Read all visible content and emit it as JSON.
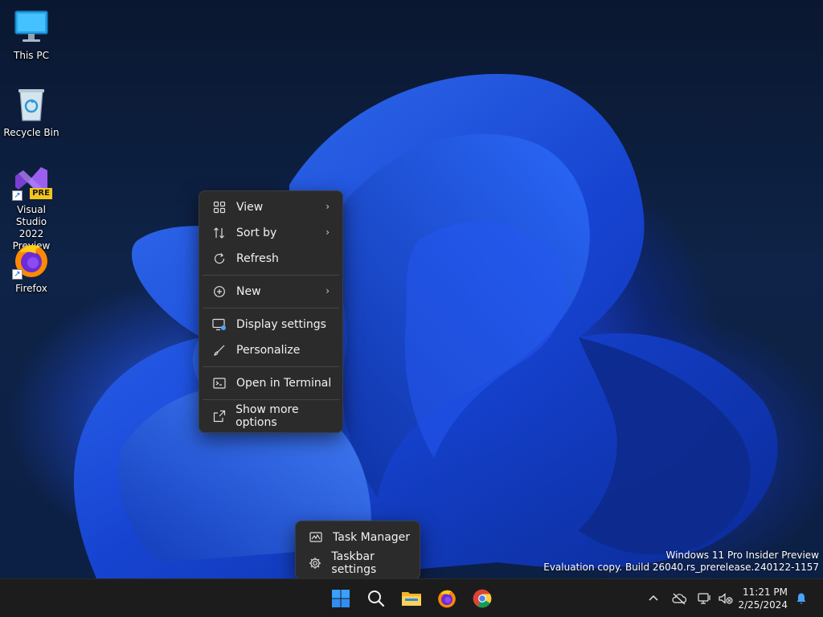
{
  "desktop": {
    "icons": [
      {
        "label": "This PC",
        "icon": "monitor-icon"
      },
      {
        "label": "Recycle Bin",
        "icon": "recycle-bin-icon"
      },
      {
        "label": "Visual Studio 2022 Preview",
        "line1": "Visual Studio",
        "line2": "2022 Preview",
        "badge": "PRE",
        "icon": "visual-studio-icon"
      },
      {
        "label": "Firefox",
        "icon": "firefox-icon"
      }
    ]
  },
  "context_menu": {
    "items": [
      {
        "label": "View",
        "icon": "view-grid-icon",
        "submenu": true
      },
      {
        "label": "Sort by",
        "icon": "sort-icon",
        "submenu": true
      },
      {
        "label": "Refresh",
        "icon": "refresh-icon",
        "submenu": false
      },
      {
        "label": "New",
        "icon": "new-plus-icon",
        "submenu": true
      },
      {
        "label": "Display settings",
        "icon": "display-settings-icon",
        "submenu": false
      },
      {
        "label": "Personalize",
        "icon": "personalize-brush-icon",
        "submenu": false
      },
      {
        "label": "Open in Terminal",
        "icon": "terminal-icon",
        "submenu": false
      },
      {
        "label": "Show more options",
        "icon": "show-more-options-icon",
        "submenu": false
      }
    ]
  },
  "taskbar_menu": {
    "items": [
      {
        "label": "Task Manager",
        "icon": "task-manager-icon"
      },
      {
        "label": "Taskbar settings",
        "icon": "gear-icon"
      }
    ]
  },
  "taskbar": {
    "pinned": [
      "start-icon",
      "search-icon",
      "file-explorer-icon",
      "firefox-icon",
      "chrome-icon"
    ],
    "tray": [
      "chevron-up-icon",
      "cloud-offline-icon",
      "network-icon",
      "volume-muted-icon",
      "notification-bell-icon"
    ],
    "time": "11:21 PM",
    "date": "2/25/2024"
  },
  "watermark": {
    "line1": "Windows 11 Pro Insider Preview",
    "line2": "Evaluation copy. Build 26040.rs_prerelease.240122-1157"
  },
  "colors": {
    "menu_bg": "#2b2b2b",
    "taskbar_bg": "#1c1c1c",
    "accent_blue": "#1f6feb",
    "wallpaper_blue": "#1f4fe0"
  }
}
